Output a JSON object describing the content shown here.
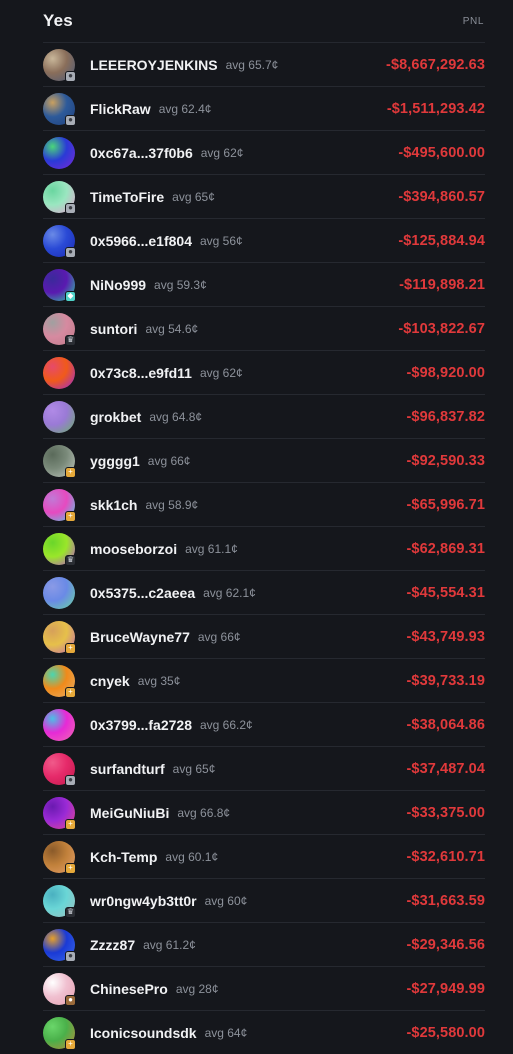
{
  "header": {
    "title": "Yes",
    "pnl_label": "PNL"
  },
  "rows": [
    {
      "name": "LEEEROYJENKINS",
      "avg": "avg 65.7¢",
      "pnl": "-$8,667,292.63",
      "colors": [
        "#8a6e5a",
        "#4a5a7a",
        "#c9b79a"
      ],
      "badge": "silver"
    },
    {
      "name": "FlickRaw",
      "avg": "avg 62.4¢",
      "pnl": "-$1,511,293.42",
      "colors": [
        "#2d5a9a",
        "#1f3f7a",
        "#c9a060"
      ],
      "badge": "silver"
    },
    {
      "name": "0xc67a...37f0b6",
      "avg": "avg 62¢",
      "pnl": "-$495,600.00",
      "colors": [
        "#2a3ad6",
        "#7a2ad6",
        "#4ad67a"
      ],
      "badge": "none"
    },
    {
      "name": "TimeToFire",
      "avg": "avg 65¢",
      "pnl": "-$394,860.57",
      "colors": [
        "#9ae6c0",
        "#e6a0d0",
        "#6ad6a0"
      ],
      "badge": "silver"
    },
    {
      "name": "0x5966...e1f804",
      "avg": "avg 56¢",
      "pnl": "-$125,884.94",
      "colors": [
        "#2a4ad6",
        "#1a2ab0",
        "#6a8ae6"
      ],
      "badge": "silver"
    },
    {
      "name": "NiNo999",
      "avg": "avg 59.3¢",
      "pnl": "-$119,898.21",
      "colors": [
        "#5a1ab0",
        "#2ad6a0",
        "#3a2a9a"
      ],
      "badge": "diamond"
    },
    {
      "name": "suntori",
      "avg": "avg 54.6¢",
      "pnl": "-$103,822.67",
      "colors": [
        "#d68aa0",
        "#c07a8a",
        "#a0a0a0"
      ],
      "badge": "crown"
    },
    {
      "name": "0x73c8...e9fd11",
      "avg": "avg 62¢",
      "pnl": "-$98,920.00",
      "colors": [
        "#f05a1a",
        "#9a2ad6",
        "#e64a6a"
      ],
      "badge": "none"
    },
    {
      "name": "grokbet",
      "avg": "avg 64.8¢",
      "pnl": "-$96,837.82",
      "colors": [
        "#9a7ad6",
        "#6ab06a",
        "#b08ae6"
      ],
      "badge": "none"
    },
    {
      "name": "ygggg1",
      "avg": "avg 66¢",
      "pnl": "-$92,590.33",
      "colors": [
        "#7a8a7a",
        "#c0c8c0",
        "#5a6a5a"
      ],
      "badge": "gold"
    },
    {
      "name": "skk1ch",
      "avg": "avg 58.9¢",
      "pnl": "-$65,996.71",
      "colors": [
        "#e64ac0",
        "#4ad6e6",
        "#c07ad6"
      ],
      "badge": "gold"
    },
    {
      "name": "mooseborzoi",
      "avg": "avg 61.1¢",
      "pnl": "-$62,869.31",
      "colors": [
        "#9ae62a",
        "#c04ad6",
        "#6ad62a"
      ],
      "badge": "crown"
    },
    {
      "name": "0x5375...c2aeea",
      "avg": "avg 62.1¢",
      "pnl": "-$45,554.31",
      "colors": [
        "#6a8ae6",
        "#6ad6a0",
        "#8a9ae6"
      ],
      "badge": "none"
    },
    {
      "name": "BruceWayne77",
      "avg": "avg 66¢",
      "pnl": "-$43,749.93",
      "colors": [
        "#e6c04a",
        "#c06ab0",
        "#d6a05a"
      ],
      "badge": "gold"
    },
    {
      "name": "cnyek",
      "avg": "avg 35¢",
      "pnl": "-$39,733.19",
      "colors": [
        "#f08a1a",
        "#e6b06a",
        "#4ad6b0"
      ],
      "badge": "gold"
    },
    {
      "name": "0x3799...fa2728",
      "avg": "avg 66.2¢",
      "pnl": "-$38,064.86",
      "colors": [
        "#e62ad6",
        "#f06ab0",
        "#4ac0e6"
      ],
      "badge": "none"
    },
    {
      "name": "surfandturf",
      "avg": "avg 65¢",
      "pnl": "-$37,487.04",
      "colors": [
        "#e62a6a",
        "#c01a4a",
        "#f05a8a"
      ],
      "badge": "silver"
    },
    {
      "name": "MeiGuNiuBi",
      "avg": "avg 66.8¢",
      "pnl": "-$33,375.00",
      "colors": [
        "#9a2ad6",
        "#e64a8a",
        "#6a1ab0"
      ],
      "badge": "gold"
    },
    {
      "name": "Kch-Temp",
      "avg": "avg 60.1¢",
      "pnl": "-$32,610.71",
      "colors": [
        "#c0803a",
        "#e6a06a",
        "#8a5a2a"
      ],
      "badge": "gold"
    },
    {
      "name": "wr0ngw4yb3tt0r",
      "avg": "avg 60¢",
      "pnl": "-$31,663.59",
      "colors": [
        "#6ad6d6",
        "#a0c0c0",
        "#4ab0c0"
      ],
      "badge": "crown"
    },
    {
      "name": "Zzzz87",
      "avg": "avg 61.2¢",
      "pnl": "-$29,346.56",
      "colors": [
        "#1a3ad6",
        "#3a6ae6",
        "#e6a02a"
      ],
      "badge": "silver"
    },
    {
      "name": "ChinesePro",
      "avg": "avg 28¢",
      "pnl": "-$27,949.99",
      "colors": [
        "#f0c0d0",
        "#e6a0b0",
        "#ffffff"
      ],
      "badge": "bronze"
    },
    {
      "name": "Iconicsoundsdk",
      "avg": "avg 64¢",
      "pnl": "-$25,580.00",
      "colors": [
        "#4ab04a",
        "#c08a3a",
        "#6ad66a"
      ],
      "badge": "gold"
    }
  ]
}
